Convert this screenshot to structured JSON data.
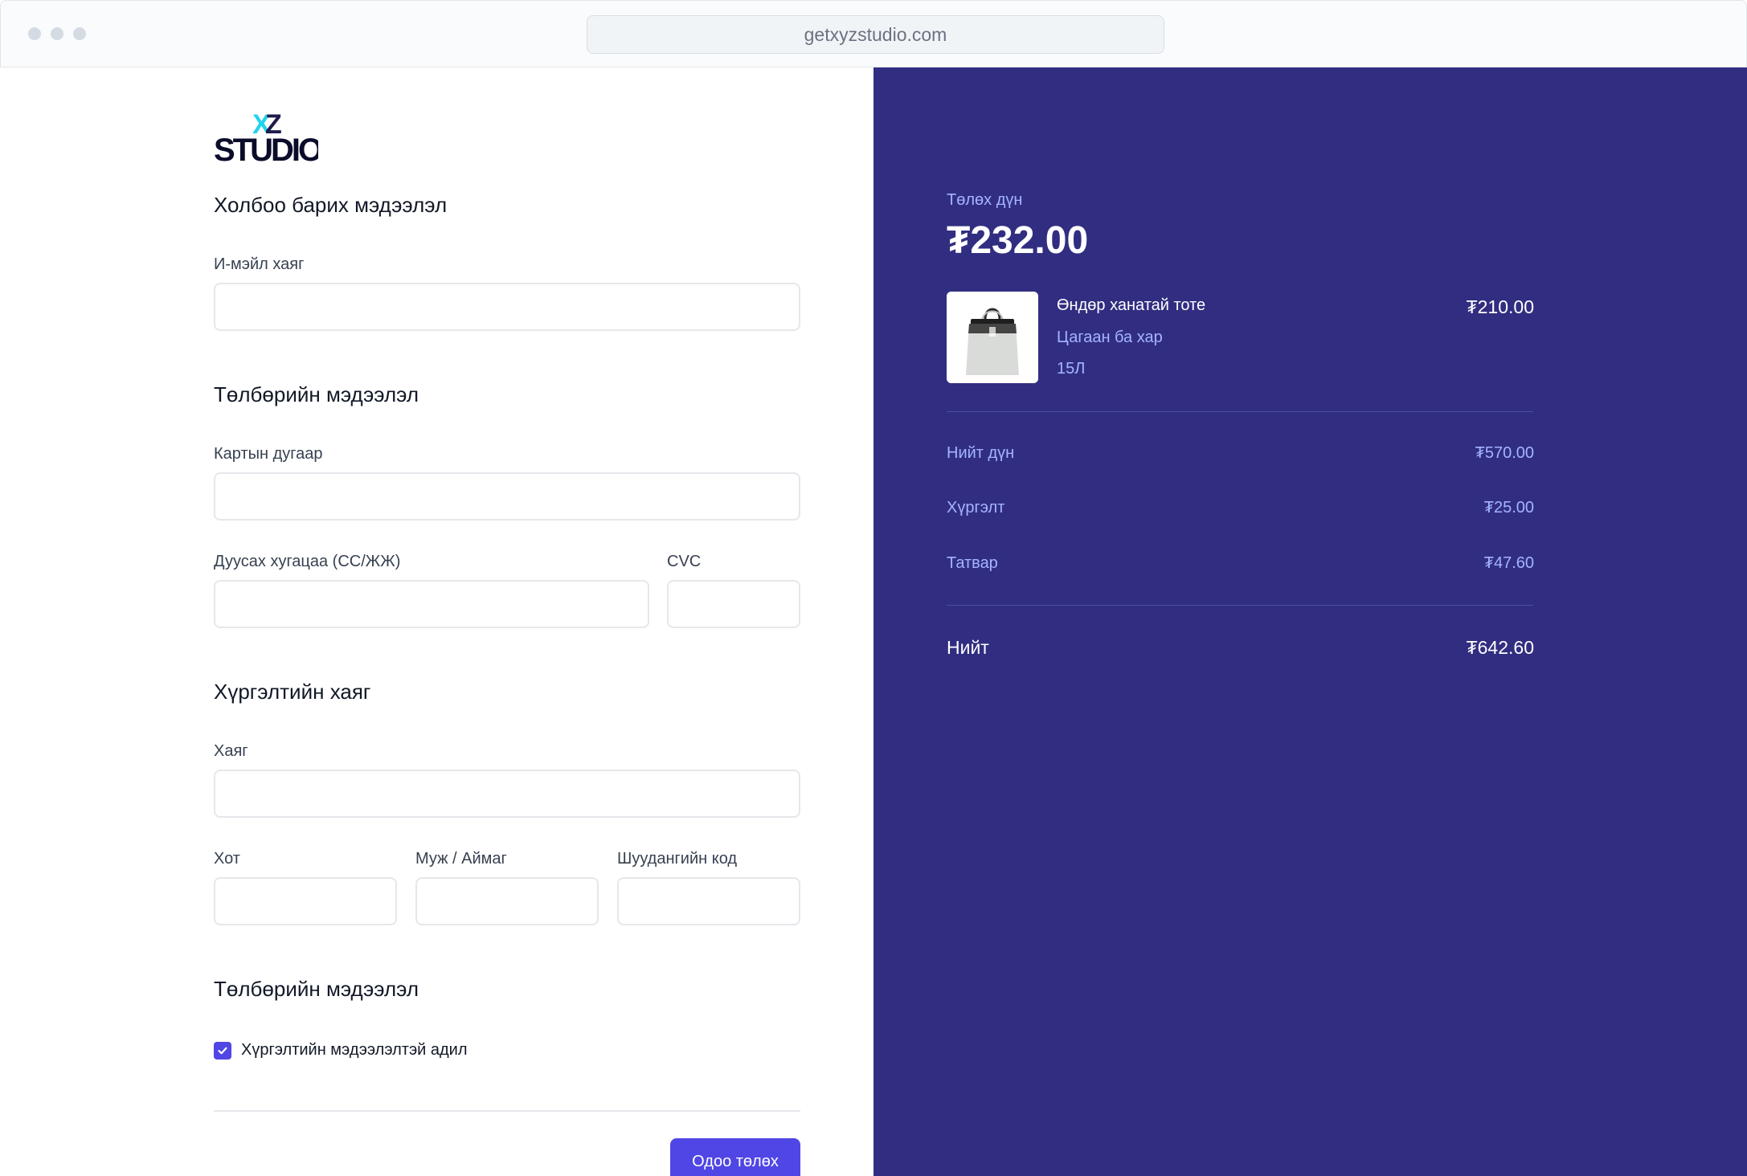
{
  "browser": {
    "url": "getxyzstudio.com"
  },
  "brand": {
    "logo_text": "XYZ STUDIO",
    "accent": "#5046e5",
    "panel_bg": "#312e81",
    "muted": "#a5b4fc"
  },
  "form": {
    "contact_title": "Холбоо барих мэдээлэл",
    "email_label": "И-мэйл хаяг",
    "email_value": "",
    "payment_title": "Төлбөрийн мэдээлэл",
    "card_label": "Картын дугаар",
    "card_value": "",
    "expiry_label": "Дуусах хугацаа (СС/ЖЖ)",
    "expiry_value": "",
    "cvc_label": "CVC",
    "cvc_value": "",
    "shipping_title": "Хүргэлтийн хаяг",
    "address_label": "Хаяг",
    "address_value": "",
    "city_label": "Хот",
    "city_value": "",
    "region_label": "Муж / Аймаг",
    "region_value": "",
    "postal_label": "Шуудангийн код",
    "postal_value": "",
    "billing_title": "Төлбөрийн мэдээлэл",
    "same_as_shipping_label": "Хүргэлтийн мэдээлэлтэй адил",
    "same_as_shipping_checked": true,
    "pay_button": "Одоо төлөх"
  },
  "summary": {
    "amount_label": "Төлөх дүн",
    "amount": "₮232.00",
    "product": {
      "name": "Өндөр ханатай тоте",
      "color": "Цагаан ба хар",
      "size": "15Л",
      "price": "₮210.00",
      "image_icon": "tote-bag-image"
    },
    "rows": [
      {
        "label": "Нийт дүн",
        "value": "₮570.00"
      },
      {
        "label": "Хүргэлт",
        "value": "₮25.00"
      },
      {
        "label": "Татвар",
        "value": "₮47.60"
      }
    ],
    "total_label": "Нийт",
    "total_value": "₮642.60"
  }
}
